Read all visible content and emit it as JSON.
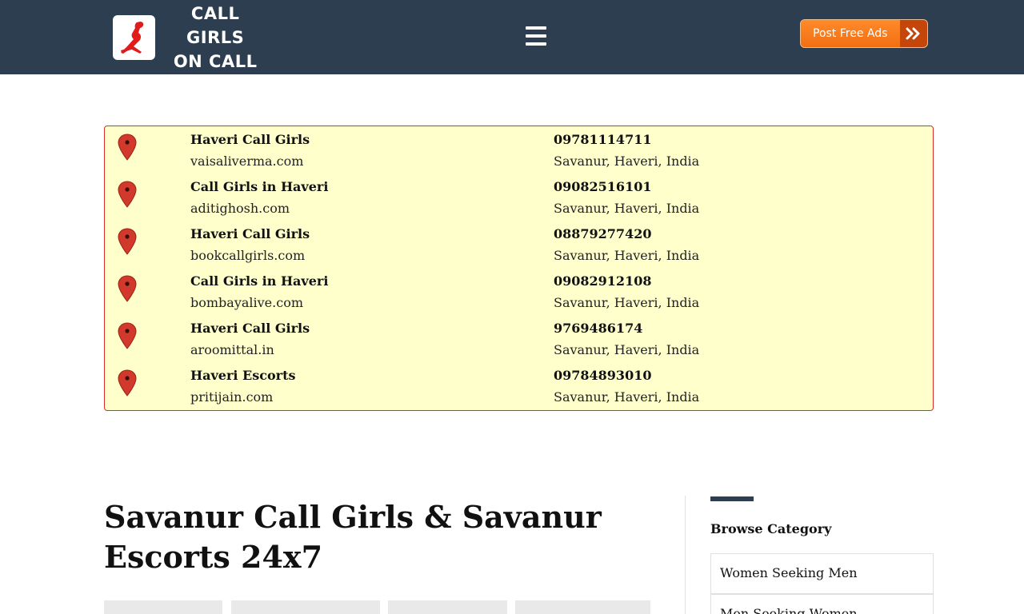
{
  "header": {
    "logo_line1": "CALL GIRLS",
    "logo_line2": "ON CALL",
    "post_button_label": "Post Free Ads",
    "colors": {
      "bar": "#2c3e50",
      "button": "#f57c20"
    }
  },
  "listings": [
    {
      "name": "Haveri Call Girls",
      "site": "vaisaliverma.com",
      "phone": "09781114711",
      "location": "Savanur, Haveri, India"
    },
    {
      "name": "Call Girls in Haveri",
      "site": "aditighosh.com",
      "phone": "09082516101",
      "location": "Savanur, Haveri, India"
    },
    {
      "name": "Haveri Call Girls",
      "site": "bookcallgirls.com",
      "phone": "08879277420",
      "location": "Savanur, Haveri, India"
    },
    {
      "name": "Call Girls in Haveri",
      "site": "bombayalive.com",
      "phone": "09082912108",
      "location": "Savanur, Haveri, India"
    },
    {
      "name": "Haveri Call Girls",
      "site": "aroomittal.in",
      "phone": "9769486174",
      "location": "Savanur, Haveri, India"
    },
    {
      "name": "Haveri Escorts",
      "site": "pritijain.com",
      "phone": "09784893010",
      "location": "Savanur, Haveri, India"
    }
  ],
  "main": {
    "title": "Savanur Call Girls & Savanur Escorts 24x7"
  },
  "sidebar": {
    "title": "Browse Category",
    "categories": [
      "Women Seeking Men",
      "Men Seeking Women"
    ]
  }
}
